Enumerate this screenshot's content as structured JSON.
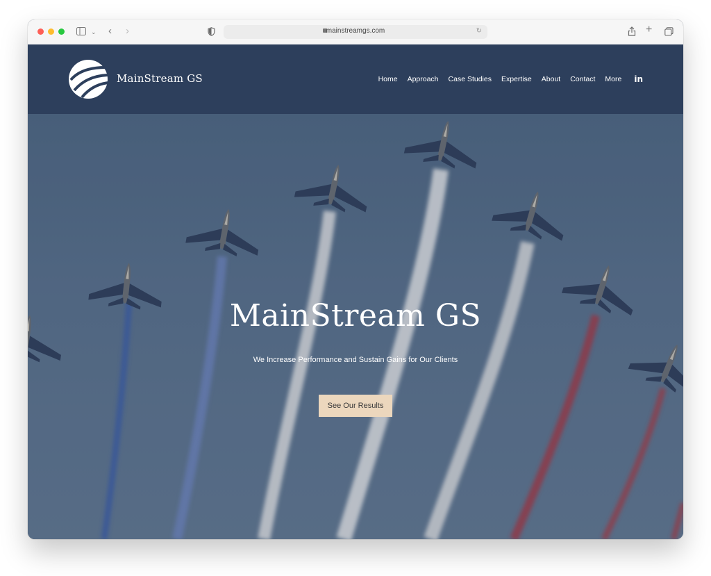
{
  "browser": {
    "url": "mainstreamgs.com",
    "icons": [
      "sidebar-icon",
      "chevron-down-icon",
      "back-icon",
      "forward-icon",
      "privacy-shield-icon",
      "reload-icon",
      "share-icon",
      "new-tab-icon",
      "tabs-overview-icon"
    ]
  },
  "header": {
    "brand": "MainStream GS",
    "nav": [
      {
        "label": "Home"
      },
      {
        "label": "Approach"
      },
      {
        "label": "Case Studies"
      },
      {
        "label": "Expertise"
      },
      {
        "label": "About"
      },
      {
        "label": "Contact"
      },
      {
        "label": "More"
      }
    ],
    "social": "in"
  },
  "hero": {
    "title": "MainStream GS",
    "subtitle": "We Increase Performance and Sustain Gains for Our Clients",
    "cta": "See Our Results"
  },
  "colors": {
    "header_bg": "#2d3f5c",
    "cta_bg": "#ecd7bd",
    "sky": "#5a718c",
    "trail_blue": "#3c5aa0",
    "trail_white": "#e6e6e6",
    "trail_red": "#a33a46"
  }
}
